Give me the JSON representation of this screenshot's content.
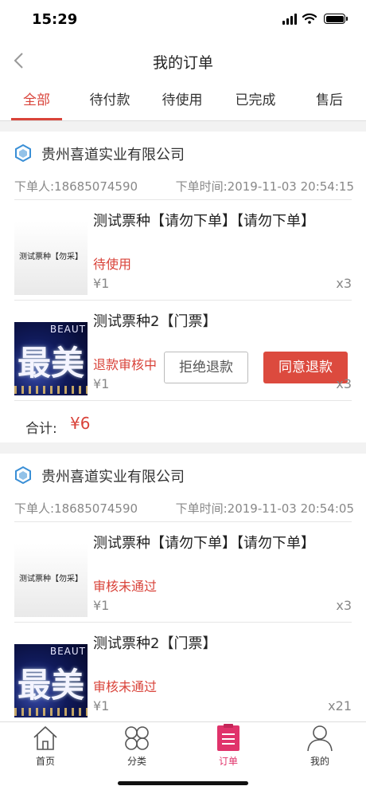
{
  "status_bar": {
    "time": "15:29"
  },
  "header": {
    "title": "我的订单"
  },
  "tabs": [
    {
      "label": "全部",
      "active": true
    },
    {
      "label": "待付款",
      "active": false
    },
    {
      "label": "待使用",
      "active": false
    },
    {
      "label": "已完成",
      "active": false
    },
    {
      "label": "售后",
      "active": false
    }
  ],
  "orders": [
    {
      "shop_name": "贵州喜道实业有限公司",
      "buyer": "下单人:18685074590",
      "order_time": "下单时间:2019-11-03 20:54:15",
      "items": [
        {
          "name": "测试票种【请勿下单】【请勿下单】",
          "thumb_text": "测试票种【勿采】",
          "status": "待使用",
          "price": "¥1",
          "qty": "x3"
        },
        {
          "name": "测试票种2【门票】",
          "thumb_caption": "BEAUT",
          "thumb_glyph": "最美",
          "status": "退款审核中",
          "price": "¥1",
          "qty": "x3",
          "reject_label": "拒绝退款",
          "agree_label": "同意退款"
        }
      ],
      "total_label": "合计:",
      "total_value": "¥6"
    },
    {
      "shop_name": "贵州喜道实业有限公司",
      "buyer": "下单人:18685074590",
      "order_time": "下单时间:2019-11-03 20:54:05",
      "items": [
        {
          "name": "测试票种【请勿下单】【请勿下单】",
          "thumb_text": "测试票种【勿采】",
          "status": "审核未通过",
          "price": "¥1",
          "qty": "x3"
        },
        {
          "name": "测试票种2【门票】",
          "thumb_caption": "BEAUT",
          "thumb_glyph": "最美",
          "status": "审核未通过",
          "price": "¥1",
          "qty": "x21"
        }
      ]
    }
  ],
  "tabbar": [
    {
      "label": "首页",
      "icon": "home-icon",
      "active": false
    },
    {
      "label": "分类",
      "icon": "category-icon",
      "active": false
    },
    {
      "label": "订单",
      "icon": "order-icon",
      "active": true
    },
    {
      "label": "我的",
      "icon": "profile-icon",
      "active": false
    }
  ],
  "colors": {
    "accent": "#d9433a",
    "tab_active": "#e0336b",
    "shop_icon": "#3a8fd6"
  }
}
